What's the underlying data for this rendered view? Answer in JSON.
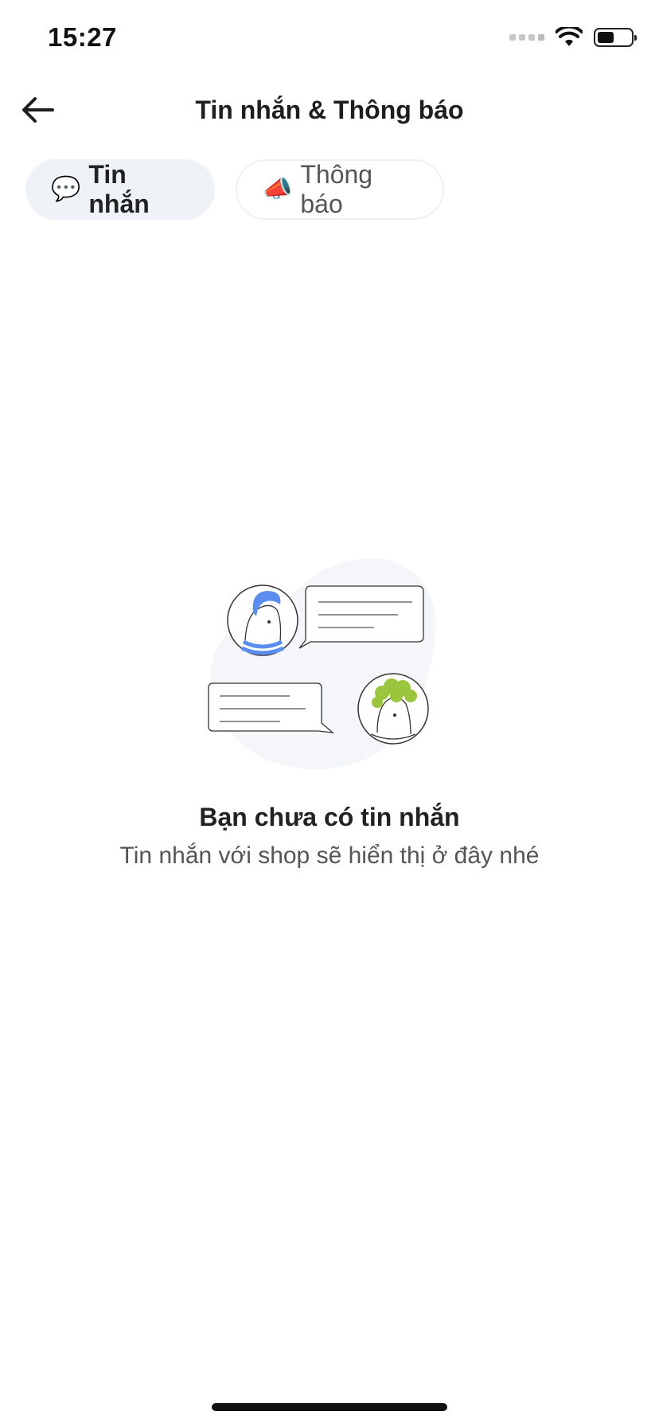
{
  "status_bar": {
    "time": "15:27"
  },
  "header": {
    "title": "Tin nhắn & Thông báo"
  },
  "tabs": [
    {
      "icon": "speech-bubble-icon",
      "emoji": "💬",
      "label": "Tin nhắn",
      "active": true
    },
    {
      "icon": "megaphone-icon",
      "emoji": "📣",
      "label": "Thông báo",
      "active": false
    }
  ],
  "empty_state": {
    "title": "Bạn chưa có tin nhắn",
    "subtitle": "Tin nhắn với shop sẽ hiển thị ở đây nhé"
  },
  "colors": {
    "active_tab_bg": "#eff2f6",
    "avatar_blue": "#5b8def",
    "avatar_green": "#9bc53d",
    "blob_bg": "#f4f6f9"
  }
}
